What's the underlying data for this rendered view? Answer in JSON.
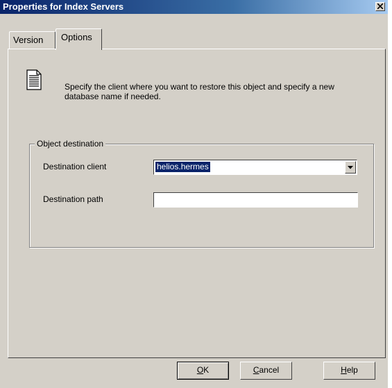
{
  "window": {
    "title": "Properties for Index Servers"
  },
  "tabs": [
    {
      "label": "Version",
      "active": false
    },
    {
      "label": "Options",
      "active": true
    }
  ],
  "options": {
    "instructions": "Specify the client where you want to restore this object and specify a new database name if needed.",
    "group_title": "Object destination",
    "destination_client_label": "Destination client",
    "destination_client_value": "helios.hermes",
    "destination_path_label": "Destination path",
    "destination_path_value": ""
  },
  "buttons": {
    "ok_prefix": "",
    "ok_mnemonic": "O",
    "ok_rest": "K",
    "cancel_mnemonic": "C",
    "cancel_rest": "ancel",
    "help_mnemonic": "H",
    "help_rest": "elp"
  },
  "colors": {
    "face": "#d4d0c8",
    "titlebar": "#0a246a",
    "selection": "#0a246a"
  }
}
